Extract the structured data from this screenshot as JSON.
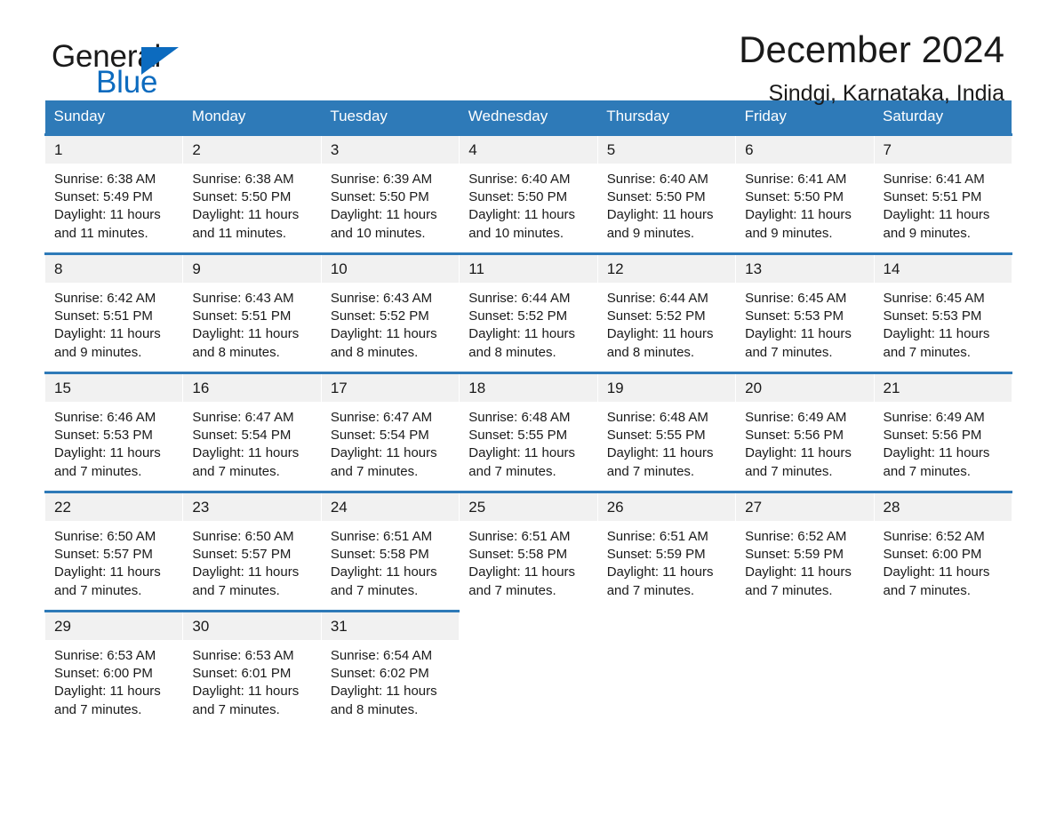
{
  "logo": {
    "word_one": "General",
    "word_two": "Blue",
    "triangle_icon": "triangle-icon",
    "accent_color": "#0c6bbf"
  },
  "header": {
    "title": "December 2024",
    "subtitle": "Sindgi, Karnataka, India"
  },
  "theme": {
    "header_blue": "#2e7ab8",
    "daynum_bg": "#f1f1f1",
    "text": "#1a1a1a"
  },
  "weekdays": [
    "Sunday",
    "Monday",
    "Tuesday",
    "Wednesday",
    "Thursday",
    "Friday",
    "Saturday"
  ],
  "labels": {
    "sunrise": "Sunrise:",
    "sunset": "Sunset:",
    "daylight": "Daylight:"
  },
  "weeks": [
    [
      {
        "day": "1",
        "sunrise": "Sunrise: 6:38 AM",
        "sunset": "Sunset: 5:49 PM",
        "daylight1": "Daylight: 11 hours",
        "daylight2": "and 11 minutes."
      },
      {
        "day": "2",
        "sunrise": "Sunrise: 6:38 AM",
        "sunset": "Sunset: 5:50 PM",
        "daylight1": "Daylight: 11 hours",
        "daylight2": "and 11 minutes."
      },
      {
        "day": "3",
        "sunrise": "Sunrise: 6:39 AM",
        "sunset": "Sunset: 5:50 PM",
        "daylight1": "Daylight: 11 hours",
        "daylight2": "and 10 minutes."
      },
      {
        "day": "4",
        "sunrise": "Sunrise: 6:40 AM",
        "sunset": "Sunset: 5:50 PM",
        "daylight1": "Daylight: 11 hours",
        "daylight2": "and 10 minutes."
      },
      {
        "day": "5",
        "sunrise": "Sunrise: 6:40 AM",
        "sunset": "Sunset: 5:50 PM",
        "daylight1": "Daylight: 11 hours",
        "daylight2": "and 9 minutes."
      },
      {
        "day": "6",
        "sunrise": "Sunrise: 6:41 AM",
        "sunset": "Sunset: 5:50 PM",
        "daylight1": "Daylight: 11 hours",
        "daylight2": "and 9 minutes."
      },
      {
        "day": "7",
        "sunrise": "Sunrise: 6:41 AM",
        "sunset": "Sunset: 5:51 PM",
        "daylight1": "Daylight: 11 hours",
        "daylight2": "and 9 minutes."
      }
    ],
    [
      {
        "day": "8",
        "sunrise": "Sunrise: 6:42 AM",
        "sunset": "Sunset: 5:51 PM",
        "daylight1": "Daylight: 11 hours",
        "daylight2": "and 9 minutes."
      },
      {
        "day": "9",
        "sunrise": "Sunrise: 6:43 AM",
        "sunset": "Sunset: 5:51 PM",
        "daylight1": "Daylight: 11 hours",
        "daylight2": "and 8 minutes."
      },
      {
        "day": "10",
        "sunrise": "Sunrise: 6:43 AM",
        "sunset": "Sunset: 5:52 PM",
        "daylight1": "Daylight: 11 hours",
        "daylight2": "and 8 minutes."
      },
      {
        "day": "11",
        "sunrise": "Sunrise: 6:44 AM",
        "sunset": "Sunset: 5:52 PM",
        "daylight1": "Daylight: 11 hours",
        "daylight2": "and 8 minutes."
      },
      {
        "day": "12",
        "sunrise": "Sunrise: 6:44 AM",
        "sunset": "Sunset: 5:52 PM",
        "daylight1": "Daylight: 11 hours",
        "daylight2": "and 8 minutes."
      },
      {
        "day": "13",
        "sunrise": "Sunrise: 6:45 AM",
        "sunset": "Sunset: 5:53 PM",
        "daylight1": "Daylight: 11 hours",
        "daylight2": "and 7 minutes."
      },
      {
        "day": "14",
        "sunrise": "Sunrise: 6:45 AM",
        "sunset": "Sunset: 5:53 PM",
        "daylight1": "Daylight: 11 hours",
        "daylight2": "and 7 minutes."
      }
    ],
    [
      {
        "day": "15",
        "sunrise": "Sunrise: 6:46 AM",
        "sunset": "Sunset: 5:53 PM",
        "daylight1": "Daylight: 11 hours",
        "daylight2": "and 7 minutes."
      },
      {
        "day": "16",
        "sunrise": "Sunrise: 6:47 AM",
        "sunset": "Sunset: 5:54 PM",
        "daylight1": "Daylight: 11 hours",
        "daylight2": "and 7 minutes."
      },
      {
        "day": "17",
        "sunrise": "Sunrise: 6:47 AM",
        "sunset": "Sunset: 5:54 PM",
        "daylight1": "Daylight: 11 hours",
        "daylight2": "and 7 minutes."
      },
      {
        "day": "18",
        "sunrise": "Sunrise: 6:48 AM",
        "sunset": "Sunset: 5:55 PM",
        "daylight1": "Daylight: 11 hours",
        "daylight2": "and 7 minutes."
      },
      {
        "day": "19",
        "sunrise": "Sunrise: 6:48 AM",
        "sunset": "Sunset: 5:55 PM",
        "daylight1": "Daylight: 11 hours",
        "daylight2": "and 7 minutes."
      },
      {
        "day": "20",
        "sunrise": "Sunrise: 6:49 AM",
        "sunset": "Sunset: 5:56 PM",
        "daylight1": "Daylight: 11 hours",
        "daylight2": "and 7 minutes."
      },
      {
        "day": "21",
        "sunrise": "Sunrise: 6:49 AM",
        "sunset": "Sunset: 5:56 PM",
        "daylight1": "Daylight: 11 hours",
        "daylight2": "and 7 minutes."
      }
    ],
    [
      {
        "day": "22",
        "sunrise": "Sunrise: 6:50 AM",
        "sunset": "Sunset: 5:57 PM",
        "daylight1": "Daylight: 11 hours",
        "daylight2": "and 7 minutes."
      },
      {
        "day": "23",
        "sunrise": "Sunrise: 6:50 AM",
        "sunset": "Sunset: 5:57 PM",
        "daylight1": "Daylight: 11 hours",
        "daylight2": "and 7 minutes."
      },
      {
        "day": "24",
        "sunrise": "Sunrise: 6:51 AM",
        "sunset": "Sunset: 5:58 PM",
        "daylight1": "Daylight: 11 hours",
        "daylight2": "and 7 minutes."
      },
      {
        "day": "25",
        "sunrise": "Sunrise: 6:51 AM",
        "sunset": "Sunset: 5:58 PM",
        "daylight1": "Daylight: 11 hours",
        "daylight2": "and 7 minutes."
      },
      {
        "day": "26",
        "sunrise": "Sunrise: 6:51 AM",
        "sunset": "Sunset: 5:59 PM",
        "daylight1": "Daylight: 11 hours",
        "daylight2": "and 7 minutes."
      },
      {
        "day": "27",
        "sunrise": "Sunrise: 6:52 AM",
        "sunset": "Sunset: 5:59 PM",
        "daylight1": "Daylight: 11 hours",
        "daylight2": "and 7 minutes."
      },
      {
        "day": "28",
        "sunrise": "Sunrise: 6:52 AM",
        "sunset": "Sunset: 6:00 PM",
        "daylight1": "Daylight: 11 hours",
        "daylight2": "and 7 minutes."
      }
    ],
    [
      {
        "day": "29",
        "sunrise": "Sunrise: 6:53 AM",
        "sunset": "Sunset: 6:00 PM",
        "daylight1": "Daylight: 11 hours",
        "daylight2": "and 7 minutes."
      },
      {
        "day": "30",
        "sunrise": "Sunrise: 6:53 AM",
        "sunset": "Sunset: 6:01 PM",
        "daylight1": "Daylight: 11 hours",
        "daylight2": "and 7 minutes."
      },
      {
        "day": "31",
        "sunrise": "Sunrise: 6:54 AM",
        "sunset": "Sunset: 6:02 PM",
        "daylight1": "Daylight: 11 hours",
        "daylight2": "and 8 minutes."
      },
      {
        "day": "",
        "sunrise": "",
        "sunset": "",
        "daylight1": "",
        "daylight2": ""
      },
      {
        "day": "",
        "sunrise": "",
        "sunset": "",
        "daylight1": "",
        "daylight2": ""
      },
      {
        "day": "",
        "sunrise": "",
        "sunset": "",
        "daylight1": "",
        "daylight2": ""
      },
      {
        "day": "",
        "sunrise": "",
        "sunset": "",
        "daylight1": "",
        "daylight2": ""
      }
    ]
  ]
}
